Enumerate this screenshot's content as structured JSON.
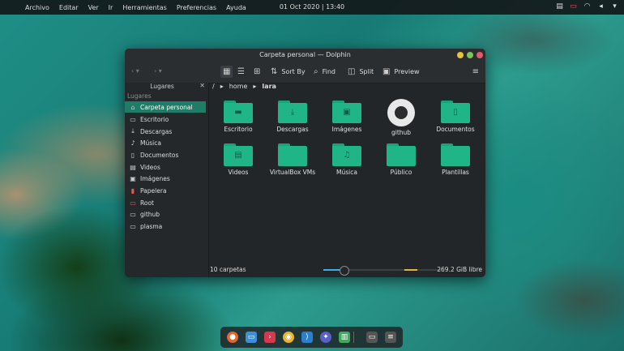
{
  "menubar": {
    "items": [
      "Archivo",
      "Editar",
      "Ver",
      "Ir",
      "Herramientas",
      "Preferencias",
      "Ayuda"
    ],
    "clock": "01 Oct 2020 | 13:40"
  },
  "tray_icons": [
    "clipboard-icon",
    "battery-icon",
    "wifi-icon",
    "volume-icon",
    "chevron-down-icon"
  ],
  "window": {
    "title": "Carpeta personal — Dolphin",
    "toolbar": {
      "sort_label": "Sort By",
      "find_label": "Find",
      "split_label": "Split",
      "preview_label": "Preview"
    }
  },
  "sidebar": {
    "title": "Lugares",
    "section": "Lugares",
    "items": [
      {
        "label": "Carpeta personal",
        "icon": "home-icon"
      },
      {
        "label": "Escritorio",
        "icon": "desktop-icon"
      },
      {
        "label": "Descargas",
        "icon": "download-icon"
      },
      {
        "label": "Música",
        "icon": "music-icon"
      },
      {
        "label": "Documentos",
        "icon": "document-icon"
      },
      {
        "label": "Videos",
        "icon": "video-icon"
      },
      {
        "label": "Imágenes",
        "icon": "image-icon"
      },
      {
        "label": "Papelera",
        "icon": "trash-icon"
      },
      {
        "label": "Root",
        "icon": "folder-red-icon"
      },
      {
        "label": "github",
        "icon": "folder-icon"
      },
      {
        "label": "plasma",
        "icon": "folder-icon"
      }
    ]
  },
  "breadcrumb": [
    "/",
    "home",
    "lara"
  ],
  "files": [
    {
      "label": "Escritorio",
      "icon": "desktop-folder-icon"
    },
    {
      "label": "Descargas",
      "icon": "download-folder-icon"
    },
    {
      "label": "Imágenes",
      "icon": "image-folder-icon"
    },
    {
      "label": "github",
      "icon": "github-icon"
    },
    {
      "label": "Documentos",
      "icon": "document-folder-icon"
    },
    {
      "label": "Videos",
      "icon": "video-folder-icon"
    },
    {
      "label": "VirtualBox VMs",
      "icon": "folder-icon"
    },
    {
      "label": "Música",
      "icon": "music-folder-icon"
    },
    {
      "label": "Público",
      "icon": "folder-icon"
    },
    {
      "label": "Plantillas",
      "icon": "folder-icon"
    }
  ],
  "status": {
    "count": "10 carpetas",
    "free": "269.2 GiB libre",
    "zoom_level": 0.25,
    "disk_used_fraction": 0.35
  },
  "dock": {
    "apps": [
      "firefox-icon",
      "files-icon",
      "terminal-icon",
      "chrome-icon",
      "vscode-icon",
      "settings-icon",
      "notes-icon"
    ],
    "extras": [
      "desktop-icon",
      "menu-icon"
    ]
  },
  "colors": {
    "accent": "#1e7d66",
    "folder": "#20b586",
    "slider": "#3daee9"
  }
}
